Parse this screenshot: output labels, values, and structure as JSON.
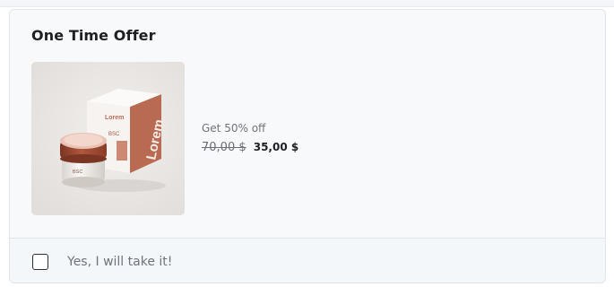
{
  "offer": {
    "title": "One Time Offer",
    "product_image": {
      "box_brand": "Lorem",
      "jar_label": "BSC",
      "icon": "cosmetic-cream-product-image"
    },
    "discount_label": "Get 50% off",
    "old_price": "70,00 $",
    "new_price": "35,00 $"
  },
  "accept": {
    "checked": false,
    "label": "Yes, I will take it!"
  }
}
